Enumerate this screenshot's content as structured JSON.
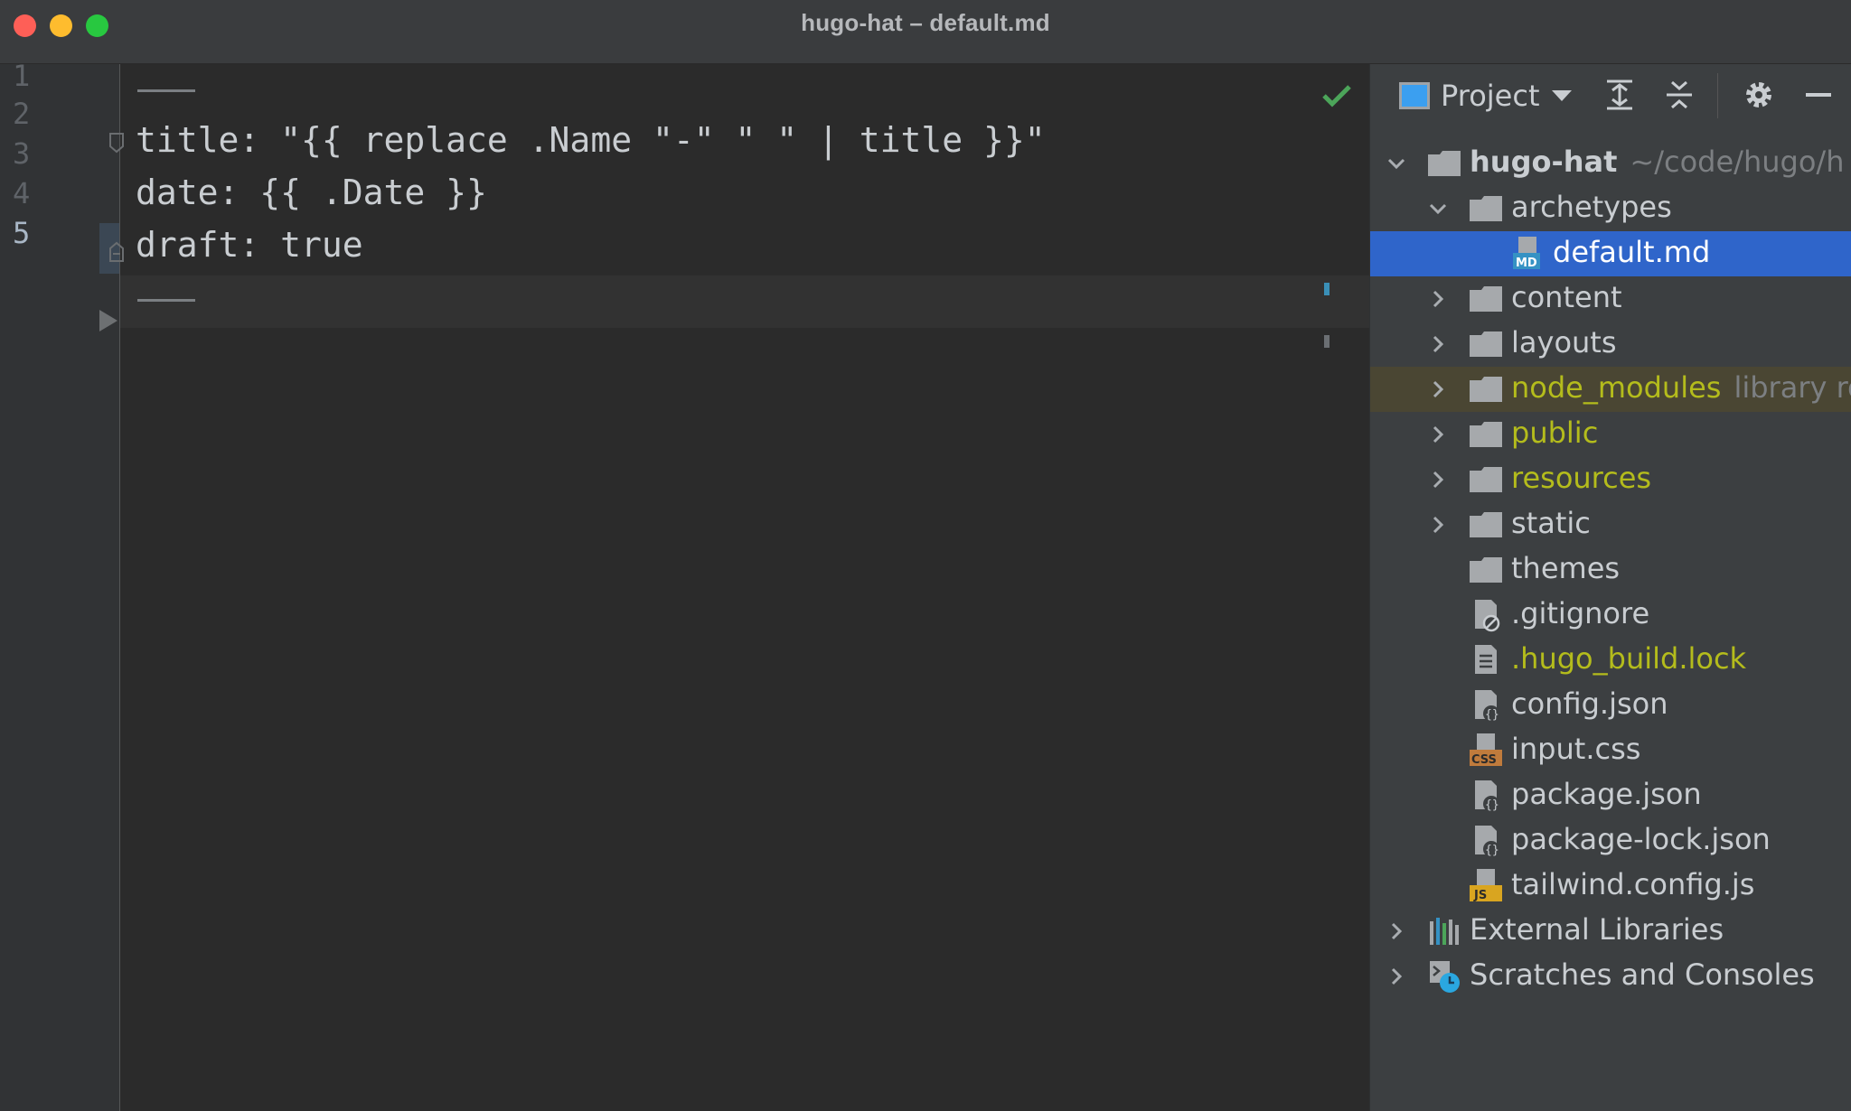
{
  "window": {
    "title": "hugo-hat – default.md"
  },
  "colors": {
    "selection": "#2f65ca",
    "excluded_text": "#b4bc1c",
    "check": "#4ca55a",
    "editor_bg": "#2b2b2b",
    "panel_bg": "#3c3f41"
  },
  "editor": {
    "line_numbers": [
      "1",
      "2",
      "3",
      "4",
      "5"
    ],
    "current_line": 5,
    "lines": [
      "---",
      "title: \"{{ replace .Name \"-\" \" \" | title }}\"",
      "date: {{ .Date }}",
      "draft: true",
      "---"
    ],
    "status_icon": "check-icon"
  },
  "project": {
    "selector_label": "Project",
    "toolbar_icons": [
      "expand-all-icon",
      "collapse-all-icon",
      "gear-icon",
      "minimize-icon"
    ],
    "root": {
      "name": "hugo-hat",
      "path": "~/code/hugo/h"
    },
    "items": [
      {
        "label": "archetypes",
        "type": "folder",
        "expanded": true
      },
      {
        "label": "default.md",
        "type": "file",
        "icon": "markdown-icon",
        "selected": true
      },
      {
        "label": "content",
        "type": "folder"
      },
      {
        "label": "layouts",
        "type": "folder"
      },
      {
        "label": "node_modules",
        "type": "folder",
        "suffix": "library ro",
        "excluded": true
      },
      {
        "label": "public",
        "type": "folder",
        "excluded": true
      },
      {
        "label": "resources",
        "type": "folder",
        "excluded": true
      },
      {
        "label": "static",
        "type": "folder"
      },
      {
        "label": "themes",
        "type": "folder"
      },
      {
        "label": ".gitignore",
        "type": "file",
        "icon": "ignore-file-icon"
      },
      {
        "label": ".hugo_build.lock",
        "type": "file",
        "icon": "text-file-icon",
        "excluded": true
      },
      {
        "label": "config.json",
        "type": "file",
        "icon": "json-file-icon"
      },
      {
        "label": "input.css",
        "type": "file",
        "icon": "css-file-icon"
      },
      {
        "label": "package.json",
        "type": "file",
        "icon": "json-file-icon"
      },
      {
        "label": "package-lock.json",
        "type": "file",
        "icon": "json-file-icon"
      },
      {
        "label": "tailwind.config.js",
        "type": "file",
        "icon": "js-file-icon"
      }
    ],
    "external_libraries": "External Libraries",
    "scratches": "Scratches and Consoles"
  }
}
